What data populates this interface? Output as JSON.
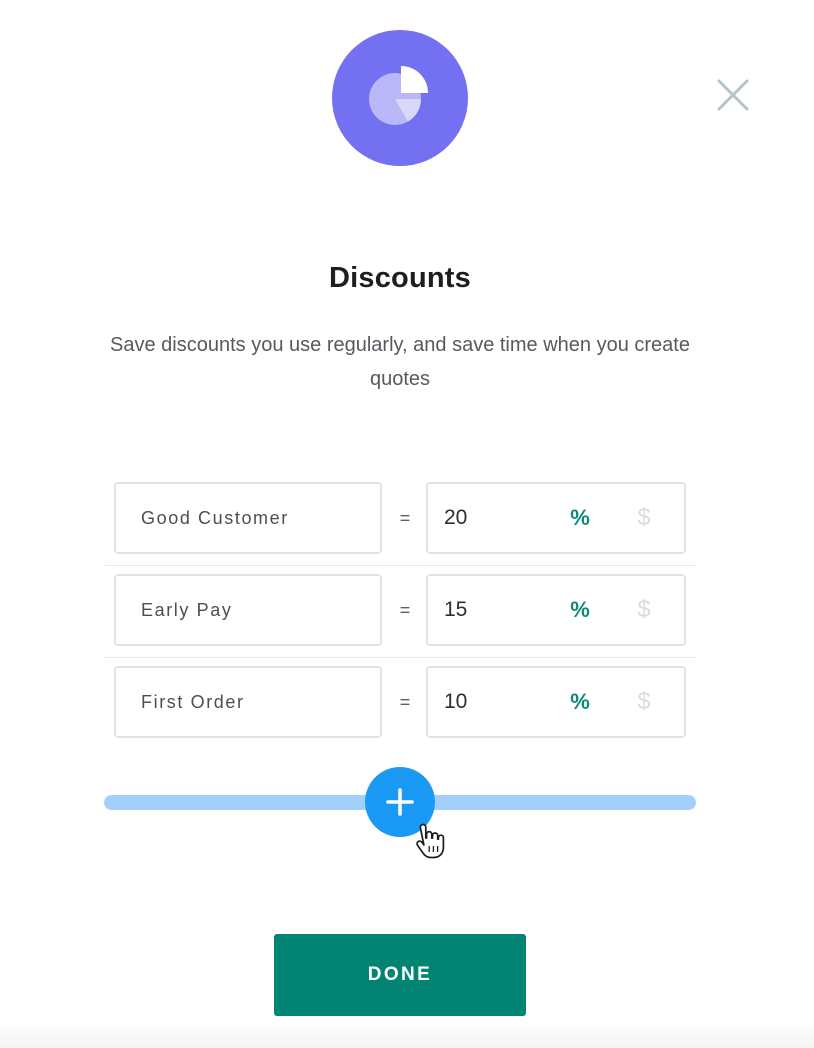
{
  "header": {
    "icon": "pie-chart-icon",
    "close_icon": "close-icon",
    "title": "Discounts",
    "subtitle": "Save discounts you use regularly, and save time when you create quotes"
  },
  "discounts": [
    {
      "name": "Good Customer",
      "equals": "=",
      "value": "20",
      "percent_label": "%",
      "dollar_label": "$",
      "selected_unit": "percent"
    },
    {
      "name": "Early Pay",
      "equals": "=",
      "value": "15",
      "percent_label": "%",
      "dollar_label": "$",
      "selected_unit": "percent"
    },
    {
      "name": "First Order",
      "equals": "=",
      "value": "10",
      "percent_label": "%",
      "dollar_label": "$",
      "selected_unit": "percent"
    }
  ],
  "add": {
    "icon": "plus-icon"
  },
  "footer": {
    "done_label": "DONE"
  },
  "colors": {
    "icon_circle": "#7370f2",
    "accent_green": "#028475",
    "percent_active": "#0e8a78",
    "dollar_inactive": "#d6dde2",
    "add_blue": "#1a9af5",
    "add_track": "#a3d0fa"
  }
}
